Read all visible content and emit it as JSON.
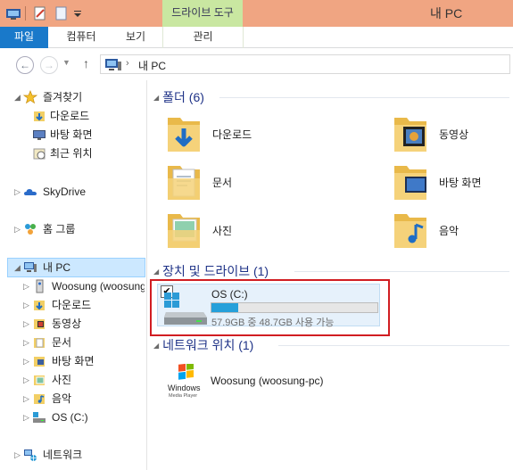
{
  "window": {
    "title": "내 PC",
    "context_tab": "드라이브 도구"
  },
  "ribbon": {
    "file_tab": "파일",
    "tabs": [
      "컴퓨터",
      "보기",
      "관리"
    ]
  },
  "address": {
    "separator": "›",
    "crumb": "내 PC"
  },
  "nav": {
    "items": [
      {
        "label": "즐겨찾기",
        "icon": "star-icon"
      },
      {
        "label": "다운로드",
        "icon": "downloads-folder-icon"
      },
      {
        "label": "바탕 화면",
        "icon": "desktop-icon"
      },
      {
        "label": "최근 위치",
        "icon": "recent-places-icon"
      },
      {
        "label": "SkyDrive",
        "icon": "skydrive-cloud-icon"
      },
      {
        "label": "홈 그룹",
        "icon": "homegroup-icon"
      },
      {
        "label": "내 PC",
        "icon": "pc-icon"
      },
      {
        "label": "Woosung (woosung-pc)",
        "icon": "media-server-icon"
      },
      {
        "label": "다운로드",
        "icon": "downloads-folder-icon"
      },
      {
        "label": "동영상",
        "icon": "videos-folder-icon"
      },
      {
        "label": "문서",
        "icon": "documents-folder-icon"
      },
      {
        "label": "바탕 화면",
        "icon": "desktop-folder-icon"
      },
      {
        "label": "사진",
        "icon": "pictures-folder-icon"
      },
      {
        "label": "음악",
        "icon": "music-folder-icon"
      },
      {
        "label": "OS (C:)",
        "icon": "drive-icon"
      },
      {
        "label": "네트워크",
        "icon": "network-icon"
      }
    ]
  },
  "groups": {
    "folders": {
      "title": "폴더 (6)",
      "items": [
        {
          "label": "다운로드",
          "icon": "downloads-folder-icon"
        },
        {
          "label": "동영상",
          "icon": "videos-folder-icon"
        },
        {
          "label": "문서",
          "icon": "documents-folder-icon"
        },
        {
          "label": "바탕 화면",
          "icon": "desktop-folder-icon"
        },
        {
          "label": "사진",
          "icon": "pictures-folder-icon"
        },
        {
          "label": "음악",
          "icon": "music-folder-icon"
        }
      ]
    },
    "drives": {
      "title": "장치 및 드라이브 (1)",
      "drive": {
        "name": "OS (C:)",
        "usage_text": "57.9GB 중 48.7GB 사용 가능",
        "used_fraction": 0.16,
        "checked_mark": "✔"
      }
    },
    "network": {
      "title": "네트워크 위치 (1)",
      "item": {
        "label": "Woosung (woosung-pc)",
        "logo_text_1": "Windows",
        "logo_text_2": "Media Player"
      }
    }
  },
  "colors": {
    "title_bar": "#f0a582",
    "context_tab": "#c9e7a1",
    "file_tab": "#1979ca",
    "group_header": "#1e3287",
    "selection": "#cce8ff",
    "highlight_box": "#d11d22",
    "capacity_fill": "#26a0da"
  }
}
